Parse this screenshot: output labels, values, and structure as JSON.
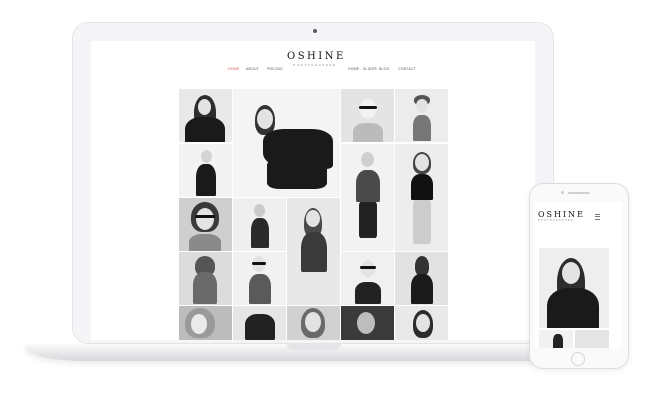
{
  "site": {
    "logo": "OSHINE",
    "logo_sub": "PHOTOGRAPHER"
  },
  "nav": {
    "left": [
      "HOME",
      "ABOUT",
      "PRICING"
    ],
    "right": [
      "HOME - SLIDER",
      "BLOG",
      "CONTACT"
    ],
    "active": "HOME",
    "accent_color": "#e24b4b"
  },
  "phone": {
    "logo": "OSHINE",
    "logo_sub": "PHOTOGRAPHER",
    "menu_icon": "hamburger-icon"
  }
}
